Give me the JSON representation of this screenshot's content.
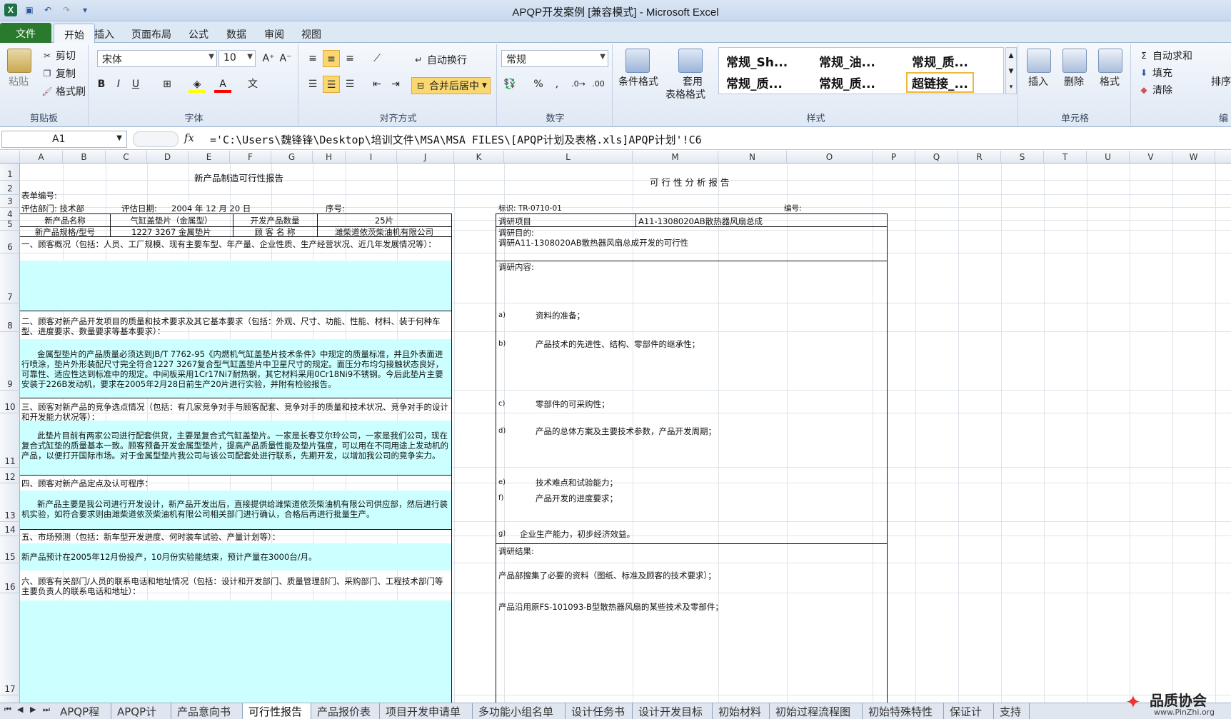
{
  "window": {
    "title": "APQP开发案例 [兼容模式] - Microsoft Excel"
  },
  "menu": {
    "file": "文件",
    "tabs": [
      "开始",
      "插入",
      "页面布局",
      "公式",
      "数据",
      "审阅",
      "视图"
    ]
  },
  "ribbon": {
    "clipboard": {
      "paste": "粘贴",
      "cut": "剪切",
      "copy": "复制",
      "format_painter": "格式刷",
      "label": "剪贴板"
    },
    "font": {
      "name": "宋体",
      "size": "10",
      "label": "字体",
      "bold": "B",
      "italic": "I",
      "underline": "U",
      "font_color": "A"
    },
    "alignment": {
      "wrap": "自动换行",
      "merge": "合并后居中",
      "label": "对齐方式"
    },
    "number": {
      "format": "常规",
      "percent": "%",
      "comma": ",",
      "label": "数字"
    },
    "styles": {
      "conditional": "条件格式",
      "table_format_1": "套用",
      "table_format_2": "表格格式",
      "cells": [
        "常规_Sh...",
        "常规_油...",
        "常规_质...",
        "常规_质...",
        "常规_质...",
        "超链接_..."
      ],
      "label": "样式"
    },
    "cells": {
      "insert": "插入",
      "delete": "删除",
      "format": "格式",
      "label": "单元格"
    },
    "editing": {
      "autosum": "自动求和",
      "fill": "填充",
      "clear": "清除",
      "sort": "排序",
      "label": "编"
    }
  },
  "formula_bar": {
    "name_box": "A1",
    "fx": "fx",
    "formula": "='C:\\Users\\魏锋锋\\Desktop\\培训文件\\MSA\\MSA FILES\\[APQP计划及表格.xls]APQP计划'!C6"
  },
  "columns": [
    "A",
    "B",
    "C",
    "D",
    "E",
    "F",
    "G",
    "H",
    "I",
    "J",
    "K",
    "L",
    "M",
    "N",
    "O",
    "P",
    "Q",
    "R",
    "S",
    "T",
    "U",
    "V",
    "W"
  ],
  "rows": [
    "1",
    "2",
    "3",
    "4",
    "5",
    "6",
    "7",
    "8",
    "9",
    "10",
    "11",
    "12",
    "13",
    "14",
    "15",
    "16",
    "17"
  ],
  "left": {
    "title": "新产品制造可行性报告",
    "form_no": "表单编号:",
    "dept": "评估部门: 技术部",
    "date_label": "评估日期:",
    "date": "2004 年 12 月 20 日",
    "seq": "序号:",
    "r4": [
      "新产品名称",
      "气缸盖垫片（金属型）",
      "开发产品数量",
      "25片"
    ],
    "r5": [
      "新产品规格/型号",
      "1227 3267 金属垫片",
      "顾 客 名 称",
      "潍柴道依茨柴油机有限公司"
    ],
    "s1": "一、顾客概况（包括：人员、工厂规模、现有主要车型、年产量、企业性质、生产经营状况、近几年发展情况等）：",
    "s2": "二、顾客对新产品开发项目的质量和技术要求及其它基本要求（包括：外观、尺寸、功能、性能、材料、装于何种车型、进度要求、数量要求等基本要求）：",
    "s2_body": "金属型垫片的产品质量必须达到JB/T 7762-95《内燃机气缸盖垫片技术条件》中规定的质量标准，并且外表面进行喷涂，垫片外形装配尺寸完全符合1227 3267复合型气缸盖垫片中卫星尺寸的规定。面压分布均匀接触状态良好，可靠性、适应性达到标准中的规定。中间板采用1Cr17Ni7耐热钢，其它材料采用0Cr18Ni9不锈钢。今后此垫片主要安装于226B发动机，要求在2005年2月28日前生产20片进行实验，并附有检验报告。",
    "s3": "三、顾客对新产品的竞争选点情况（包括：有几家竞争对手与顾客配套、竞争对手的质量和技术状况、竞争对手的设计和开发能力状况等）：",
    "s3_body": "此垫片目前有两家公司进行配套供货，主要是复合式气缸盖垫片。一家是长春艾尔玲公司，一家是我们公司，现在复合式缸垫的质量基本一致。顾客预备开发金属型垫片，提高产品质量性能及垫片强度，可以用在不同用途上发动机的产品，以便打开国际市场。对于金属型垫片我公司与该公司配套处进行联系，先期开发，以增加我公司的竞争实力。",
    "s4": "四、顾客对新产品定点及认可程序：",
    "s4_body": "新产品主要是我公司进行开发设计，新产品开发出后，直接提供给潍柴道依茨柴油机有限公司供应部，然后进行装机实验，如符合要求则由潍柴道依茨柴油机有限公司相关部门进行确认，合格后再进行批量生产。",
    "s5": "五、市场预测（包括：新车型开发进度、何时装车试验、产量计划等）：",
    "s5_body": "新产品预计在2005年12月份投产，10月份实验能结束，预计产量在3000台/月。",
    "s6": "六、顾客有关部门/人员的联系电话和地址情况（包括：设计和开发部门、质量管理部门、采购部门、工程技术部门等主要负责人的联系电话和地址）："
  },
  "right": {
    "title": "可 行 性 分 析 报 告",
    "mark": "标识: TR-0710-01",
    "code": "编号:",
    "item_label": "调研项目",
    "item_value": "A11-1308020AB散热器风扇总成",
    "purpose_label": "调研目的:",
    "purpose": "调研A11-1308020AB散热器风扇总成开发的可行性",
    "content_label": "调研内容:",
    "a": "a)",
    "a_text": "资料的准备；",
    "b": "b)",
    "b_text": "产品技术的先进性、结构、零部件的继承性；",
    "c": "c)",
    "c_text": "零部件的可采购性；",
    "d": "d)",
    "d_text": "产品的总体方案及主要技术参数，产品开发周期；",
    "e": "e)",
    "e_text": "技术难点和试验能力；",
    "f": "f)",
    "f_text": "产品开发的进度要求；",
    "g": "g)",
    "g_text": "企业生产能力，初步经济效益。",
    "result_label": "调研结果:",
    "result1": "产品部搜集了必要的资料（图纸、标准及顾客的技术要求）；",
    "result2": "产品沿用原FS-101093-B型散热器风扇的某些技术及零部件；"
  },
  "sheets": [
    "APQP程序",
    "APQP计划",
    "产品意向书",
    "可行性报告",
    "产品报价表",
    "项目开发申请单",
    "多功能小组名单",
    "设计任务书",
    "设计开发目标",
    "初始材料",
    "初始过程流程图",
    "初始特殊特性",
    "保证计划",
    "支持"
  ],
  "active_sheet": "可行性报告",
  "watermark": {
    "line1": "品质协会",
    "line2": "www.PinZhi.org"
  }
}
